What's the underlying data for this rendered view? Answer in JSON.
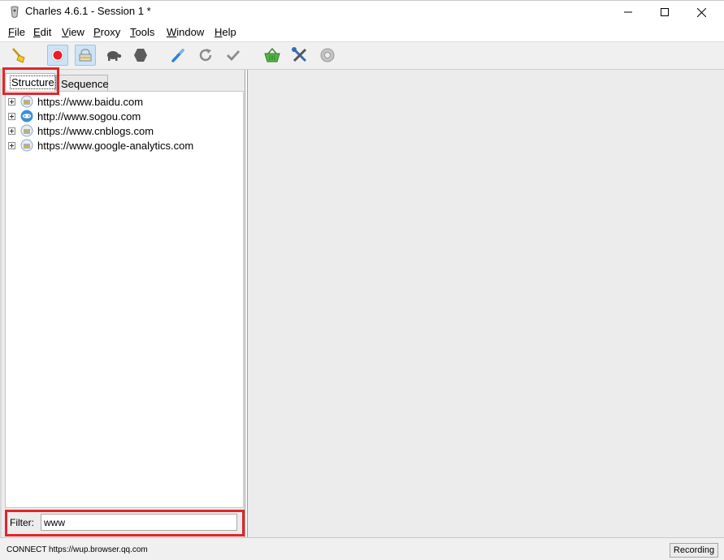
{
  "window": {
    "title": "Charles 4.6.1 - Session 1 *"
  },
  "menu": [
    {
      "label": "File",
      "mnemonic": "F",
      "rest": "ile"
    },
    {
      "label": "Edit",
      "mnemonic": "E",
      "rest": "dit"
    },
    {
      "label": "View",
      "mnemonic": "V",
      "rest": "iew"
    },
    {
      "label": "Proxy",
      "mnemonic": "P",
      "rest": "roxy"
    },
    {
      "label": "Tools",
      "mnemonic": "T",
      "rest": "ools"
    },
    {
      "label": "Window",
      "mnemonic": "W",
      "rest": "indow"
    },
    {
      "label": "Help",
      "mnemonic": "H",
      "rest": "elp"
    }
  ],
  "toolbar": {
    "icons": [
      "broom-icon",
      "record-icon",
      "ssl-proxy-icon",
      "throttle-turtle-icon",
      "breakpoint-hexagon-icon",
      "compose-pen-icon",
      "repeat-icon",
      "validate-check-icon",
      "basket-icon",
      "tools-icon",
      "settings-gear-icon"
    ],
    "active": [
      "record-icon",
      "ssl-proxy-icon"
    ]
  },
  "tabs": {
    "structure": "Structure",
    "sequence": "Sequence"
  },
  "tree": [
    {
      "host": "https://www.baidu.com",
      "icon": "secure-host-icon"
    },
    {
      "host": "http://www.sogou.com",
      "icon": "web-globe-icon"
    },
    {
      "host": "https://www.cnblogs.com",
      "icon": "secure-host-icon"
    },
    {
      "host": "https://www.google-analytics.com",
      "icon": "secure-host-icon"
    }
  ],
  "filter": {
    "label": "Filter:",
    "value": "www"
  },
  "status": {
    "text": "CONNECT https://wup.browser.qq.com",
    "recording_label": "Recording"
  },
  "colors": {
    "highlight_red": "#e0262b",
    "record_red": "#e8202a",
    "active_button_blue": "#cde4f7"
  }
}
